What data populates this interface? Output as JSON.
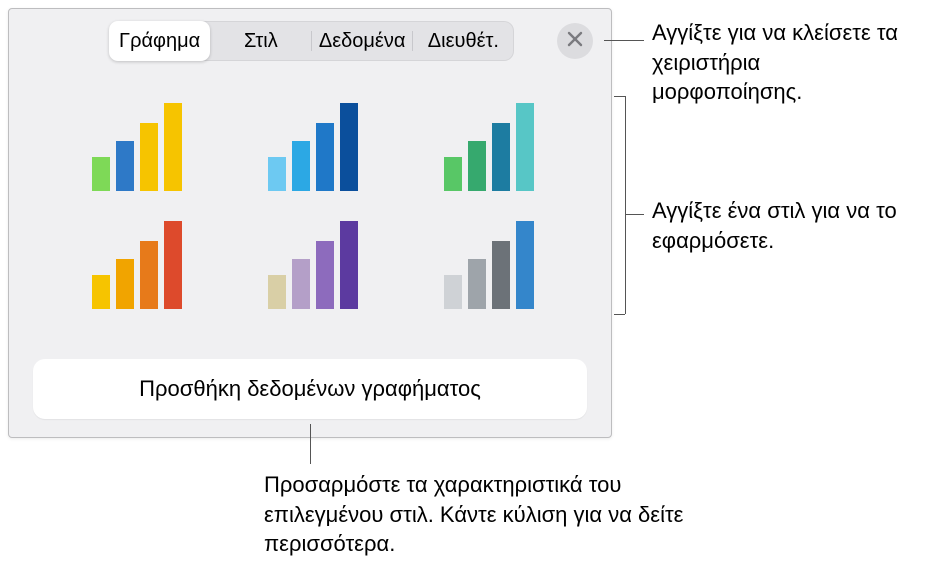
{
  "tabs": {
    "chart": "Γράφημα",
    "style": "Στιλ",
    "data": "Δεδομένα",
    "arrange": "Διευθέτ."
  },
  "button": {
    "add_chart_data": "Προσθήκη δεδομένων γραφήματος"
  },
  "callouts": {
    "close": "Αγγίξτε για να κλείσετε τα χειριστήρια μορφοποίησης.",
    "style": "Αγγίξτε ένα στιλ για να το εφαρμόσετε.",
    "bottom": "Προσαρμόστε τα χαρακτηριστικά του επιλεγμένου στιλ. Κάντε κύλιση για να δείτε περισσότερα."
  }
}
